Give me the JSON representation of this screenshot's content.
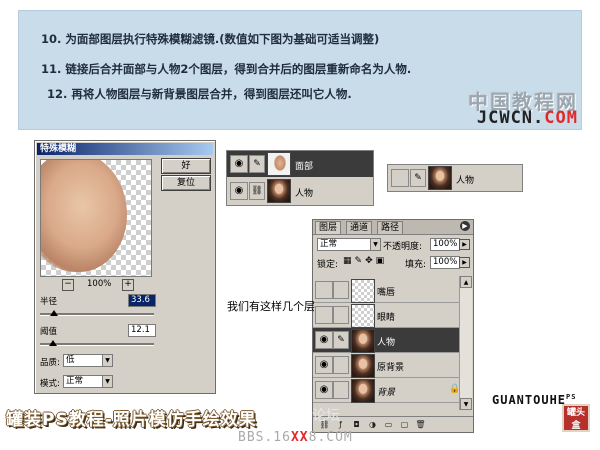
{
  "steps": [
    "10. 为面部图层执行特殊模糊滤镜.(数值如下图为基础可适当调整)",
    "11. 链接后合并面部与人物2个图层，得到合并后的图层重新命名为人物.",
    "12. 再将人物图层与新背景图层合并，得到图层还叫它人物."
  ],
  "logo": {
    "cn": "中国教程网",
    "en_a": "JCWCN.",
    "en_b": "COM"
  },
  "dialog": {
    "title": "特殊模糊",
    "ok": "好",
    "reset": "复位",
    "zoom_minus": "−",
    "zoom": "100%",
    "zoom_plus": "+",
    "radius_label": "半径",
    "radius_value": "33.6",
    "threshold_label": "阈值",
    "threshold_value": "12.1",
    "quality_label": "品质:",
    "quality_value": "低",
    "mode_label": "模式:",
    "mode_value": "正常"
  },
  "mini_layers": {
    "face": "面部",
    "person": "人物",
    "person2": "人物"
  },
  "layers_panel": {
    "tabs": [
      "图层",
      "通道",
      "路径"
    ],
    "blend_mode": "正常",
    "opacity_label": "不透明度:",
    "opacity_value": "100%",
    "lock_label": "锁定:",
    "fill_label": "填充:",
    "fill_value": "100%",
    "layers": [
      {
        "name": "嘴唇",
        "thumb": "checker",
        "visible": false,
        "selected": false
      },
      {
        "name": "眼睛",
        "thumb": "checker",
        "visible": false,
        "selected": false
      },
      {
        "name": "人物",
        "thumb": "portrait",
        "visible": true,
        "selected": true
      },
      {
        "name": "原背景",
        "thumb": "portrait",
        "visible": true,
        "selected": false
      },
      {
        "name": "背景",
        "thumb": "portrait",
        "visible": true,
        "selected": false
      }
    ]
  },
  "caption": "我们有这样几个层",
  "footer_title": "罐装PS教程-照片模仿手绘效果",
  "bbs": {
    "a": "BBS.16",
    "b": "XX",
    "c": "8.COM"
  },
  "brand": {
    "name": "GUANTOUHE",
    "sup": "PS"
  },
  "seal": "罐头盒",
  "watermark_ghost": "论坛",
  "colors": {
    "panel_bg": "#c9dcea",
    "selected_layer": "#3b3b3b",
    "logo_red": "#e02a2a"
  }
}
